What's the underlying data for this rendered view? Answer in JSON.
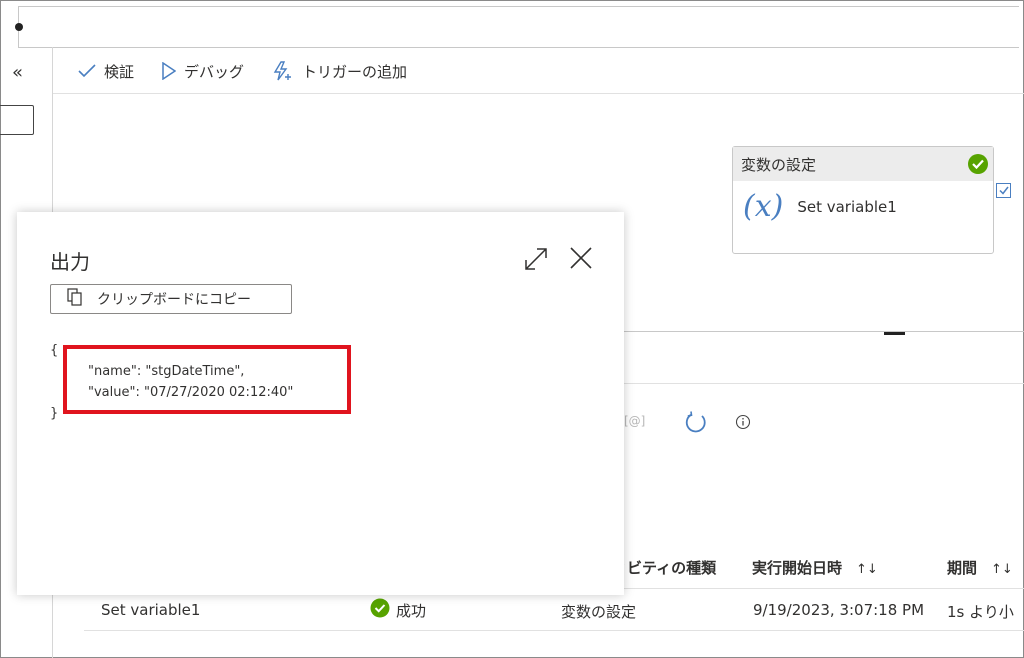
{
  "toolbar": {
    "validate_label": "検証",
    "debug_label": "デバッグ",
    "add_trigger_label": "トリガーの追加"
  },
  "nav": {
    "collapse_glyph": "«"
  },
  "activity": {
    "header": "変数の設定",
    "symbol": "(x)",
    "name": "Set variable1"
  },
  "output_panel": {
    "title": "出力",
    "copy_label": "クリップボードにコピー",
    "code_open": "{",
    "code_line1": "\"name\": \"stgDateTime\",",
    "code_line2": "\"value\": \"07/27/2020 02:12:40\"",
    "code_close": "}"
  },
  "monitor": {
    "at_label": "[@]",
    "columns": [
      "ィビティの種類",
      "実行開始日時",
      "期間"
    ],
    "sort_glyph": "↑↓",
    "row": {
      "activity_name": "Set variable1",
      "status": "成功",
      "activity_type": "変数の設定",
      "start_time": "9/19/2023, 3:07:18 PM",
      "duration": "1s より小"
    }
  },
  "colors": {
    "accent": "#4a7fc1",
    "success": "#57a300",
    "highlight": "#e0141e"
  }
}
